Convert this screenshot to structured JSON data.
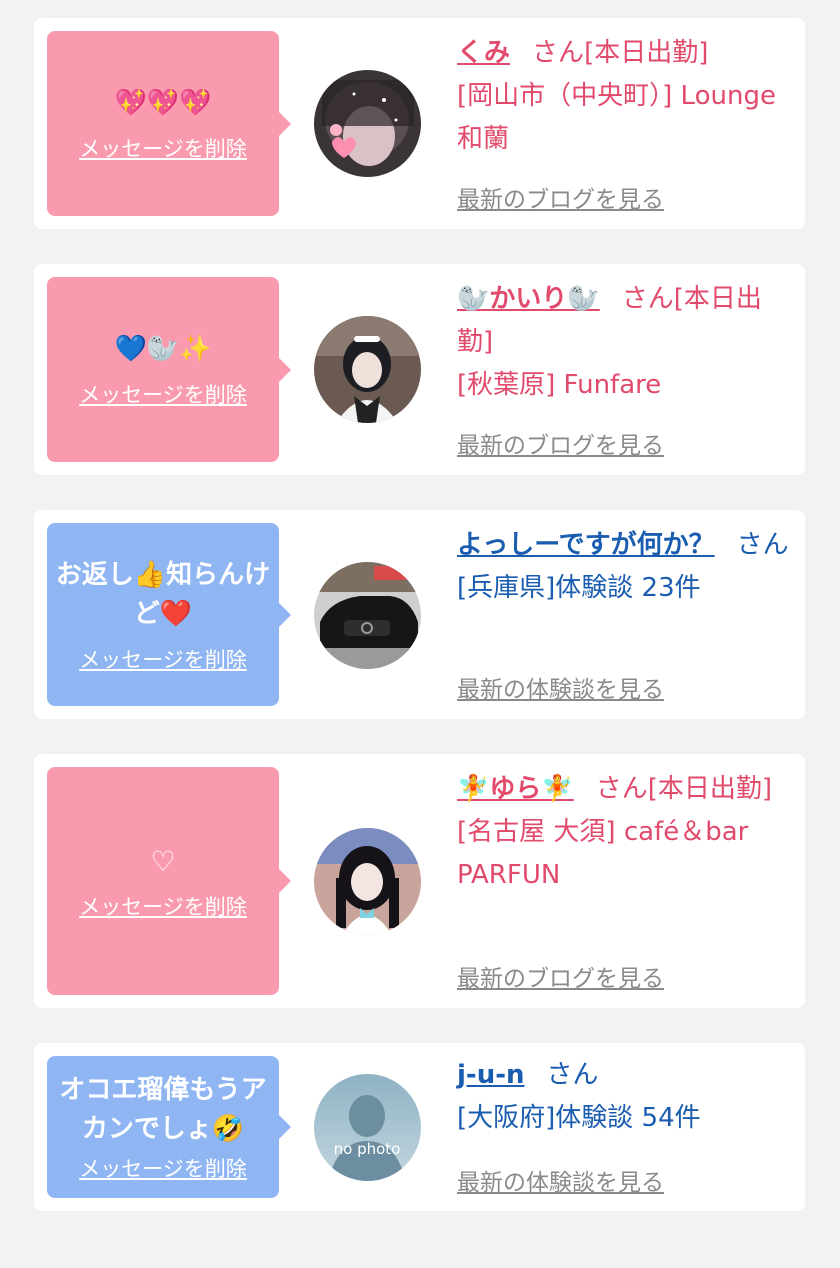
{
  "items": [
    {
      "message": "💖💖💖",
      "delete_label": "メッセージを削除",
      "name": "くみ",
      "honorific": "さん",
      "status": "[本日出勤]",
      "detail": "[岡山市（中央町）] Lounge 和蘭",
      "more_link": "最新のブログを見る",
      "type": "cast",
      "avatar": "avatar-photo-woman-sparkle-filter"
    },
    {
      "message": "💙🦭✨",
      "delete_label": "メッセージを削除",
      "name": "🦭かいり🦭",
      "honorific": "さん",
      "status": "[本日出勤]",
      "detail": "[秋葉原] Funfare",
      "more_link": "最新のブログを見る",
      "type": "cast",
      "avatar": "avatar-photo-maid"
    },
    {
      "message": "お返し👍知らんけど❤️",
      "delete_label": "メッセージを削除",
      "name": "よっしーですが何か？",
      "honorific": "さん",
      "status": "",
      "detail": "[兵庫県]体験談 23件",
      "more_link": "最新の体験談を見る",
      "type": "member",
      "avatar": "avatar-photo-black-car"
    },
    {
      "message": "♡",
      "delete_label": "メッセージを削除",
      "name": "🧚ゆら🧚",
      "honorific": "さん",
      "status": "[本日出勤]",
      "detail": "[名古屋 大須] café＆bar PARFUN",
      "more_link": "最新のブログを見る",
      "type": "cast",
      "avatar": "avatar-photo-girl-twin-tails"
    },
    {
      "message": "オコエ瑠偉もうアカンでしょ🤣",
      "delete_label": "メッセージを削除",
      "name": "j-u-n",
      "honorific": "さん",
      "status": "",
      "detail": "[大阪府]体験談 54件",
      "more_link": "最新の体験談を見る",
      "type": "member",
      "avatar": "avatar-no-photo",
      "avatar_text": "no photo"
    }
  ],
  "colors": {
    "page_background": "#f2f2f2",
    "card_background": "#ffffff",
    "cast_bubble": "#fa9aae",
    "member_bubble": "#8fb6f3",
    "cast_text": "#e24a6c",
    "member_text": "#1a5db0",
    "link_gray": "#8a8a8a"
  }
}
